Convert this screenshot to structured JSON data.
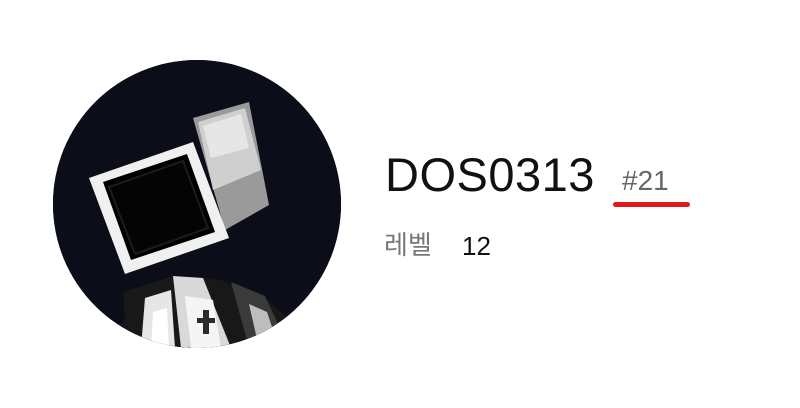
{
  "profile": {
    "username": "DOS0313",
    "tag": "#21",
    "level_label": "레벨",
    "level_value": "12",
    "avatar_icon": "tv-head-character-avatar"
  },
  "colors": {
    "accent": "#e01a1a",
    "avatar_background": "#0b0d18",
    "username_text": "#111111",
    "secondary_text": "#666666"
  }
}
